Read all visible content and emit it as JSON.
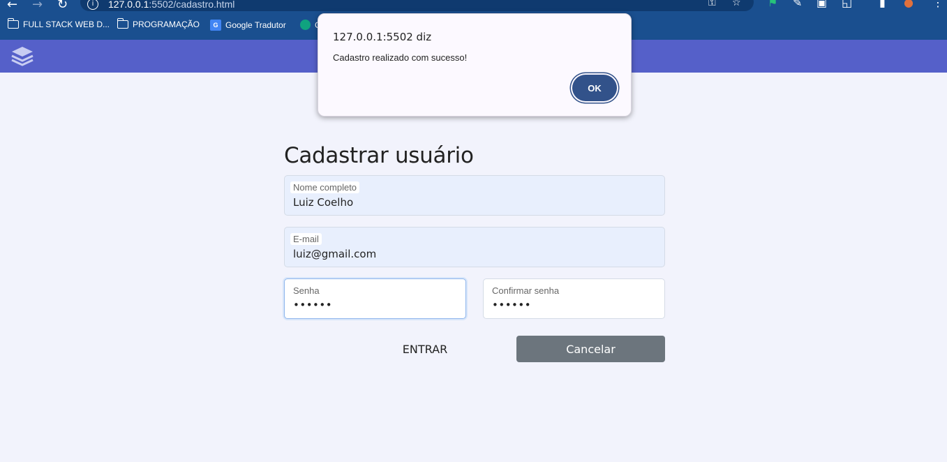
{
  "browser": {
    "url_host": "127.0.0.1",
    "url_rest": ":5502/cadastro.html",
    "bookmarks": [
      {
        "label": "FULL STACK WEB D...",
        "icon": "folder-icon"
      },
      {
        "label": "PROGRAMAÇÃO",
        "icon": "folder-icon"
      },
      {
        "label": "Google Tradutor",
        "icon": "google-translate-icon"
      },
      {
        "label": "C",
        "icon": "chatgpt-icon"
      }
    ]
  },
  "app": {
    "logo_icon": "layers-icon",
    "header_color": "#5560c9"
  },
  "form": {
    "title": "Cadastrar usuário",
    "fields": [
      {
        "label": "Nome completo",
        "value": "Luiz Coelho"
      },
      {
        "label": "E-mail",
        "value": "luiz@gmail.com"
      },
      {
        "label": "Senha",
        "value": "••••••"
      },
      {
        "label": "Confirmar senha",
        "value": "••••••"
      }
    ],
    "submit_label": "ENTRAR",
    "cancel_label": "Cancelar"
  },
  "dialog": {
    "title": "127.0.0.1:5502 diz",
    "message": "Cadastro realizado com sucesso!",
    "ok_label": "OK"
  }
}
